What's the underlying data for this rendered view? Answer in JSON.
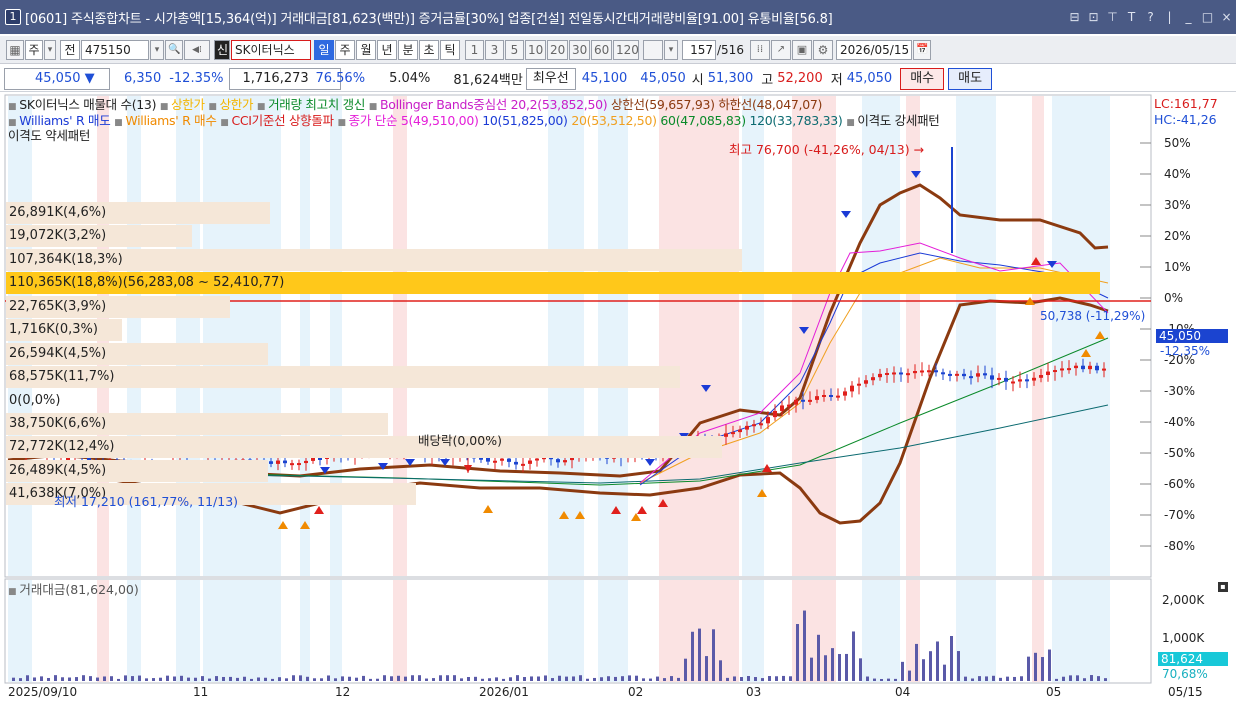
{
  "window": {
    "number": "1",
    "title": "[0601] 주식종합차트 - 시가총액[15,364(억)] 거래대금[81,623(백만)] 증거금률[30%] 업종[건설] 전일동시간대거래량비율[91.00] 유통비율[56.8]",
    "buttons": [
      "⊟",
      "⊡",
      "⊤",
      "T",
      "?",
      "|",
      "_",
      "□",
      "×"
    ]
  },
  "toolbar": {
    "layout_icon": "▦",
    "market": "주",
    "market_arrow": "▾",
    "jeon": "전",
    "code": "475150",
    "code_arrow": "▾",
    "search_icon": "🔍",
    "sound_icon": "◀⁞",
    "new_badge": "신",
    "stock_name": "SK이터닉스",
    "periods": [
      "일",
      "주",
      "월",
      "년",
      "분",
      "초",
      "틱"
    ],
    "selected_period": "일",
    "intervals": [
      "1",
      "3",
      "5",
      "10",
      "20",
      "30",
      "60",
      "120"
    ],
    "count": "157",
    "count_total": "/516",
    "icon_names": [
      "dotted-chart-icon",
      "trend-line-icon",
      "save-icon",
      "gear-icon"
    ],
    "date": "2026/05/15",
    "calendar_icon": "📅"
  },
  "quote": {
    "price": "45,050",
    "direction": "▼",
    "change": "6,350",
    "change_pct": "-12.35%",
    "volume": "1,716,273",
    "vol_ratio": "76.56%",
    "turnover": "5.04%",
    "amount": "81,624백만",
    "best_label": "최우선",
    "best_ask": "45,100",
    "best_bid": "45,050",
    "open_label": "시",
    "open": "51,300",
    "high_label": "고",
    "high": "52,200",
    "low_label": "저",
    "low": "45,050",
    "buy_label": "매수",
    "sell_label": "매도"
  },
  "legend": {
    "line1": [
      {
        "text": "SK이터닉스 매물대 수(13)",
        "color": "#222"
      },
      {
        "text": "상한가",
        "color": "#f3b400"
      },
      {
        "text": "상한가",
        "color": "#f3b400"
      },
      {
        "text": "거래량 최고치 갱신",
        "color": "#0b8a2a"
      },
      {
        "text": "Bollinger Bands중심선 20,2(53,852,50)",
        "color": "#c81ec8"
      },
      {
        "text": "상한선(59,657,93)",
        "color": "#8b3a10"
      },
      {
        "text": "하한선(48,047,07)",
        "color": "#8b3a10"
      }
    ],
    "line2": [
      {
        "text": "Williams' R 매도",
        "color": "#1b3bd6"
      },
      {
        "text": "Williams' R 매수",
        "color": "#f08a00"
      },
      {
        "text": "CCI기준선 상향돌파",
        "color": "#d81c1c"
      },
      {
        "text": "종가 단순 5(49,510,00)",
        "color": "#e41ed8"
      },
      {
        "text": "10(51,825,00)",
        "color": "#1b3bd6"
      },
      {
        "text": "20(53,512,50)",
        "color": "#f0a020"
      },
      {
        "text": "60(47,085,83)",
        "color": "#0b8a2a"
      },
      {
        "text": "120(33,783,33)",
        "color": "#0b6a70"
      },
      {
        "text": "이격도 강세패턴",
        "color": "#222"
      }
    ],
    "line3": "이격도 약세패턴",
    "lc": "LC:161,77",
    "hc": "HC:-41,26"
  },
  "volume_profile": [
    "26,891K(4,6%)",
    "19,072K(3,2%)",
    "107,364K(18,3%)",
    "110,365K(18,8%)(56,283,08 ~ 52,410,77)",
    "22,765K(3,9%)",
    "1,716K(0,3%)",
    "26,594K(4,5%)",
    "68,575K(11,7%)",
    "0(0,0%)",
    "38,750K(6,6%)",
    "72,772K(12,4%)",
    "26,489K(4,5%)",
    "41,638K(7,0%)"
  ],
  "annotations": {
    "high": "최고 76,700 (-41,26%, 04/13) →",
    "low": "최저 17,210 (161,77%, 11/13)",
    "dividend": "배당락(0,00%)",
    "current_line": "50,738 (-11,29%)"
  },
  "price_axis": {
    "ticks": [
      "50%",
      "40%",
      "30%",
      "20%",
      "10%",
      "0%",
      "-10%",
      "-20%",
      "-30%",
      "-40%",
      "-50%",
      "-60%",
      "-70%",
      "-80%"
    ],
    "current": "45,050",
    "current_pct": "-12,35%"
  },
  "volume_panel": {
    "label": "거래대금(81,624,00)",
    "ticks": [
      "2,000K",
      "1,000K"
    ],
    "current": "81,624",
    "current_pct": "70,68%"
  },
  "date_axis": [
    "2025/09/10",
    "11",
    "12",
    "2026/01",
    "02",
    "03",
    "04",
    "05",
    "05/15"
  ],
  "colors": {
    "up": "#e0201c",
    "down": "#1b44d0",
    "bollinger": "#8b3a10",
    "profile_bg": "#f5e7d8",
    "profile_max": "#ffc81a"
  }
}
